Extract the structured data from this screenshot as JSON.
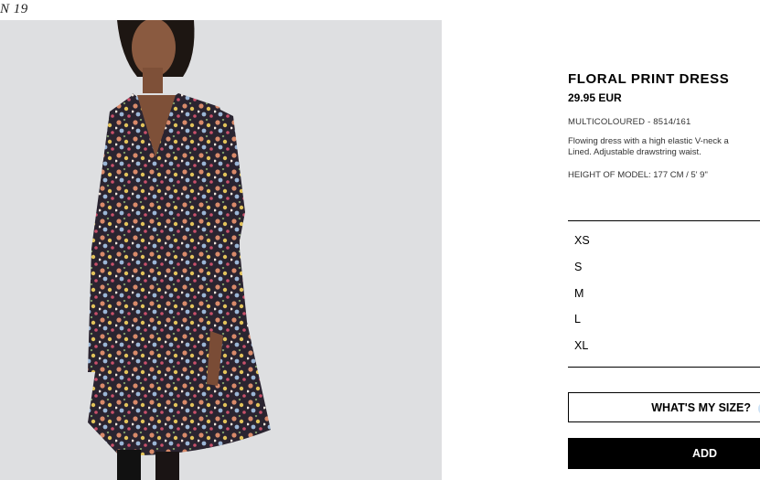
{
  "header": {
    "season_label": "N 19"
  },
  "product": {
    "title": "FLORAL PRINT DRESS",
    "price": "29.95 EUR",
    "reference": "MULTICOLOURED - 8514/161",
    "description_line1": "Flowing dress with a high elastic V-neck a",
    "description_line2": "Lined. Adjustable drawstring waist.",
    "model_height": "HEIGHT OF MODEL: 177 CM / 5' 9\""
  },
  "sizes": [
    "XS",
    "S",
    "M",
    "L",
    "XL"
  ],
  "actions": {
    "whats_my_size": "WHAT'S MY SIZE?",
    "add": "ADD"
  },
  "icons": {
    "size_helper": "circle-icon"
  }
}
